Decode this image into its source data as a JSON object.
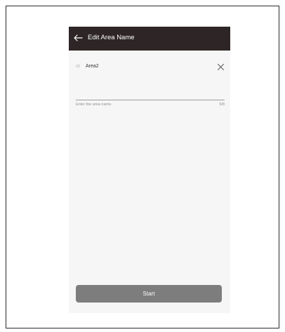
{
  "header": {
    "title": "Edit Area Name",
    "back_icon": "arrow-left-icon"
  },
  "field": {
    "index": "#2",
    "value": "Area2",
    "clear_icon": "close-icon",
    "helper": "Enter the area name.",
    "counter": "5/8"
  },
  "footer": {
    "start_label": "Start"
  },
  "colors": {
    "app_bar": "#2e2626",
    "background": "#f6f6f6",
    "button": "#7d7d7d"
  }
}
